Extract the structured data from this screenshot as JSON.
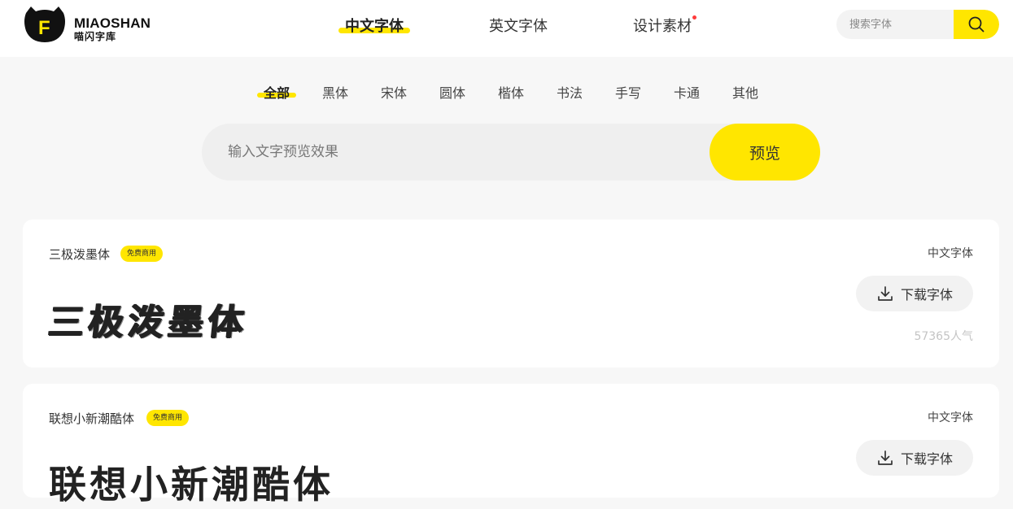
{
  "brand": {
    "name_en": "MIAOSHAN",
    "name_cn": "喵闪字库",
    "logo_letter": "F"
  },
  "nav": {
    "items": [
      {
        "label": "中文字体",
        "active": true
      },
      {
        "label": "英文字体",
        "active": false
      },
      {
        "label": "设计素材",
        "active": false,
        "dot": true
      }
    ]
  },
  "search": {
    "placeholder": "搜索字体",
    "icon": "search-icon"
  },
  "categories": [
    {
      "label": "全部",
      "active": true
    },
    {
      "label": "黑体"
    },
    {
      "label": "宋体"
    },
    {
      "label": "圆体"
    },
    {
      "label": "楷体"
    },
    {
      "label": "书法"
    },
    {
      "label": "手写"
    },
    {
      "label": "卡通"
    },
    {
      "label": "其他"
    }
  ],
  "preview": {
    "placeholder": "输入文字预览效果",
    "button_label": "预览"
  },
  "fonts": [
    {
      "name": "三极泼墨体",
      "badge": "免费商用",
      "type": "中文字体",
      "sample": "三极泼墨体",
      "download_label": "下载字体",
      "popularity": "57365人气"
    },
    {
      "name": "联想小新潮酷体",
      "badge": "免费商用",
      "type": "中文字体",
      "sample": "联想小新潮酷体",
      "download_label": "下载字体"
    }
  ],
  "colors": {
    "accent": "#ffe600",
    "page_bg": "#f7f7f7",
    "dot": "#ff3b3b"
  }
}
